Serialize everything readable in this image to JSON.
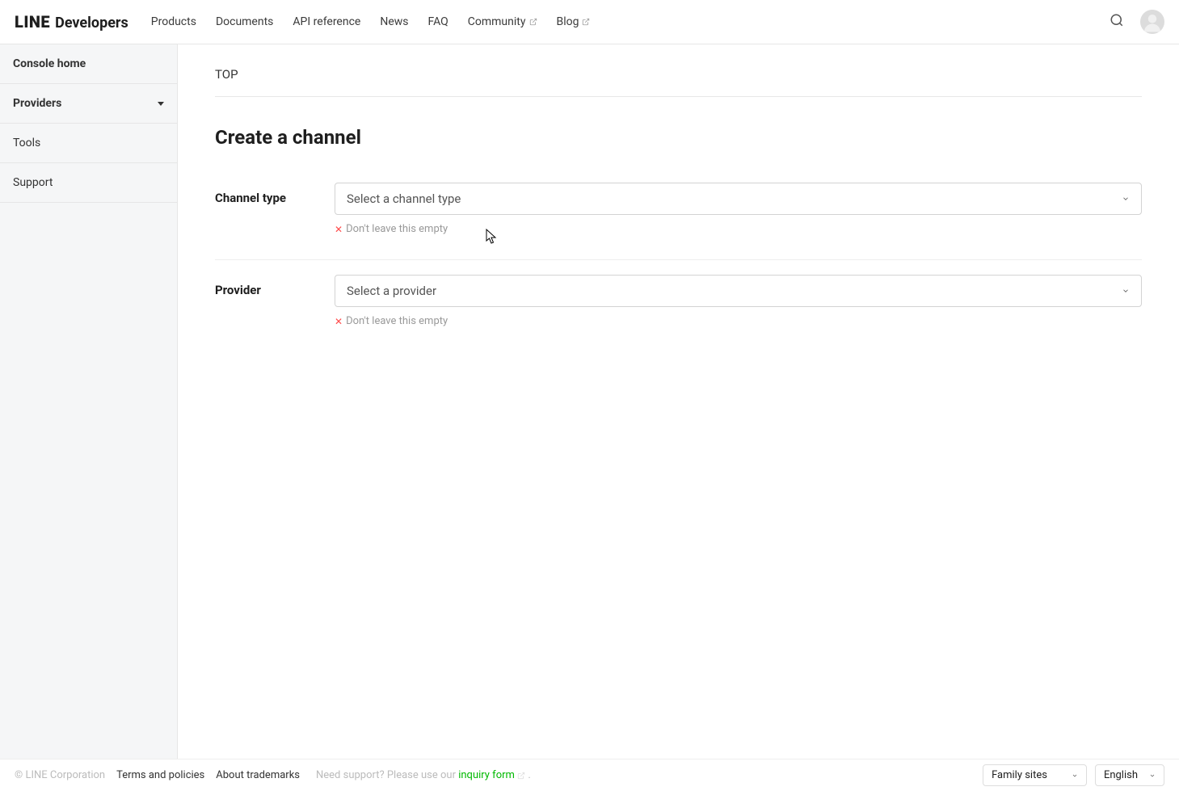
{
  "header": {
    "logo_line": "LINE",
    "logo_dev": "Developers",
    "nav": [
      {
        "label": "Products",
        "external": false
      },
      {
        "label": "Documents",
        "external": false
      },
      {
        "label": "API reference",
        "external": false
      },
      {
        "label": "News",
        "external": false
      },
      {
        "label": "FAQ",
        "external": false
      },
      {
        "label": "Community",
        "external": true
      },
      {
        "label": "Blog",
        "external": true
      }
    ]
  },
  "sidebar": {
    "items": [
      {
        "label": "Console home",
        "name": "console-home",
        "active": true,
        "dropdown": false
      },
      {
        "label": "Providers",
        "name": "providers",
        "active": false,
        "dropdown": true
      },
      {
        "label": "Tools",
        "name": "tools",
        "active": false,
        "dropdown": false
      },
      {
        "label": "Support",
        "name": "support",
        "active": false,
        "dropdown": false
      }
    ]
  },
  "main": {
    "breadcrumb": "TOP",
    "title": "Create a channel",
    "fields": {
      "channel_type": {
        "label": "Channel type",
        "placeholder": "Select a channel type",
        "error": "Don't leave this empty"
      },
      "provider": {
        "label": "Provider",
        "placeholder": "Select a provider",
        "error": "Don't leave this empty"
      }
    }
  },
  "footer": {
    "copyright": "© LINE Corporation",
    "terms": "Terms and policies",
    "trademarks": "About trademarks",
    "support_prefix": "Need support? Please use our ",
    "inquiry": "inquiry form",
    "support_suffix": " .",
    "family_sites": "Family sites",
    "language": "English"
  }
}
